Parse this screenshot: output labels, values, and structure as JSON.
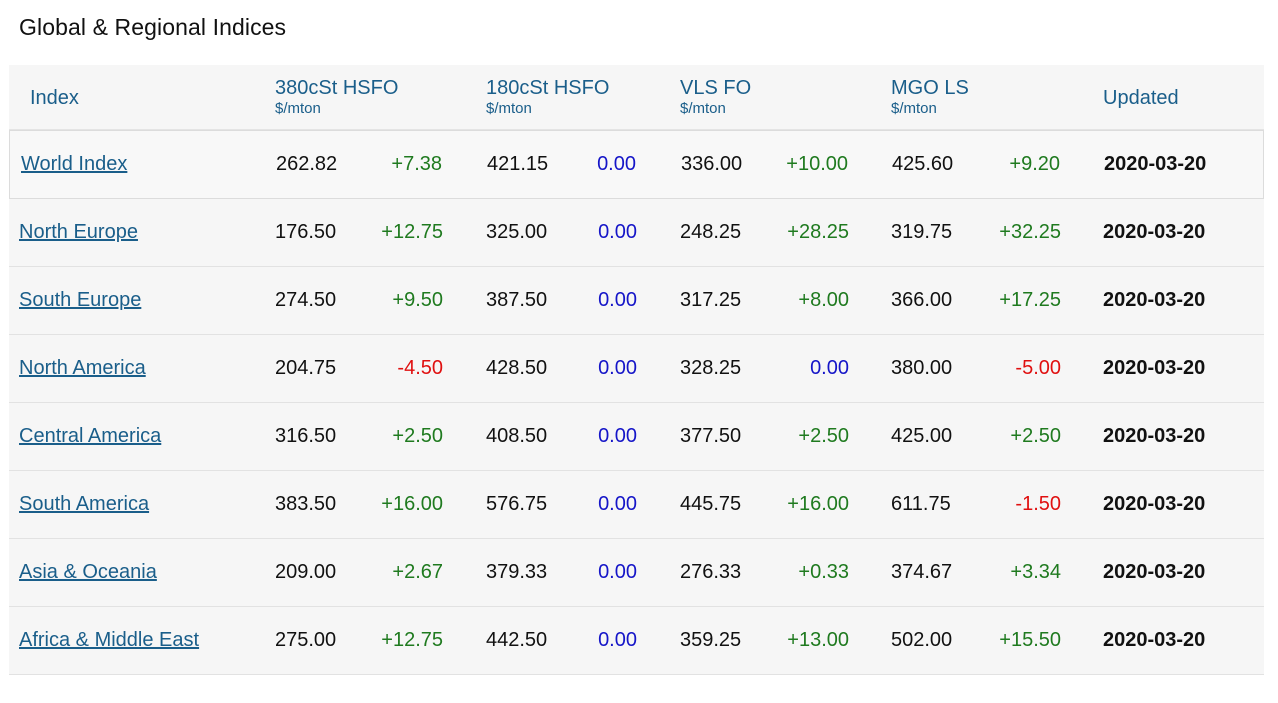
{
  "page": {
    "title": "Global & Regional Indices"
  },
  "columns": {
    "index": "Index",
    "hsfo380": {
      "title": "380cSt HSFO",
      "unit": "$/mton"
    },
    "hsfo180": {
      "title": "180cSt HSFO",
      "unit": "$/mton"
    },
    "vlsfo": {
      "title": "VLS FO",
      "unit": "$/mton"
    },
    "mgols": {
      "title": "MGO LS",
      "unit": "$/mton"
    },
    "updated": "Updated"
  },
  "colors": {
    "link": "#1a5e8a",
    "positive": "#1f7a1f",
    "negative": "#e01010",
    "zero": "#1515c8"
  },
  "rows": [
    {
      "name": "World Index",
      "hsfo380": "262.82",
      "hsfo380_chg": "+7.38",
      "hsfo180": "421.15",
      "hsfo180_chg": "0.00",
      "vlsfo": "336.00",
      "vlsfo_chg": "+10.00",
      "mgols": "425.60",
      "mgols_chg": "+9.20",
      "updated": "2020-03-20"
    },
    {
      "name": "North Europe",
      "hsfo380": "176.50",
      "hsfo380_chg": "+12.75",
      "hsfo180": "325.00",
      "hsfo180_chg": "0.00",
      "vlsfo": "248.25",
      "vlsfo_chg": "+28.25",
      "mgols": "319.75",
      "mgols_chg": "+32.25",
      "updated": "2020-03-20"
    },
    {
      "name": "South Europe",
      "hsfo380": "274.50",
      "hsfo380_chg": "+9.50",
      "hsfo180": "387.50",
      "hsfo180_chg": "0.00",
      "vlsfo": "317.25",
      "vlsfo_chg": "+8.00",
      "mgols": "366.00",
      "mgols_chg": "+17.25",
      "updated": "2020-03-20"
    },
    {
      "name": "North America",
      "hsfo380": "204.75",
      "hsfo380_chg": "-4.50",
      "hsfo180": "428.50",
      "hsfo180_chg": "0.00",
      "vlsfo": "328.25",
      "vlsfo_chg": "0.00",
      "mgols": "380.00",
      "mgols_chg": "-5.00",
      "updated": "2020-03-20"
    },
    {
      "name": "Central America",
      "hsfo380": "316.50",
      "hsfo380_chg": "+2.50",
      "hsfo180": "408.50",
      "hsfo180_chg": "0.00",
      "vlsfo": "377.50",
      "vlsfo_chg": "+2.50",
      "mgols": "425.00",
      "mgols_chg": "+2.50",
      "updated": "2020-03-20"
    },
    {
      "name": "South America",
      "hsfo380": "383.50",
      "hsfo380_chg": "+16.00",
      "hsfo180": "576.75",
      "hsfo180_chg": "0.00",
      "vlsfo": "445.75",
      "vlsfo_chg": "+16.00",
      "mgols": "611.75",
      "mgols_chg": "-1.50",
      "updated": "2020-03-20"
    },
    {
      "name": "Asia & Oceania",
      "hsfo380": "209.00",
      "hsfo380_chg": "+2.67",
      "hsfo180": "379.33",
      "hsfo180_chg": "0.00",
      "vlsfo": "276.33",
      "vlsfo_chg": "+0.33",
      "mgols": "374.67",
      "mgols_chg": "+3.34",
      "updated": "2020-03-20"
    },
    {
      "name": "Africa & Middle East",
      "hsfo380": "275.00",
      "hsfo380_chg": "+12.75",
      "hsfo180": "442.50",
      "hsfo180_chg": "0.00",
      "vlsfo": "359.25",
      "vlsfo_chg": "+13.00",
      "mgols": "502.00",
      "mgols_chg": "+15.50",
      "updated": "2020-03-20"
    }
  ]
}
